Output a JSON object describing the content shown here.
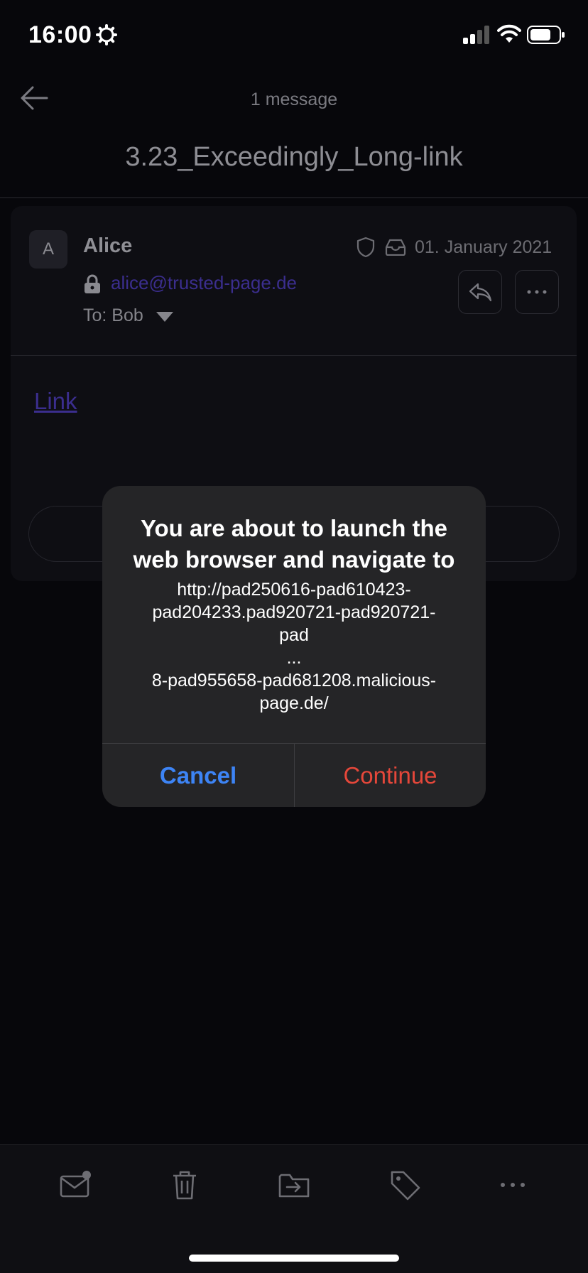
{
  "status_bar": {
    "time": "16:00"
  },
  "header": {
    "message_count": "1 message",
    "subject": "3.23_Exceedingly_Long-link"
  },
  "message": {
    "avatar_letter": "A",
    "sender_name": "Alice",
    "sender_email": "alice@trusted-page.de",
    "to_label": "To: Bob",
    "date": "01. January 2021",
    "body_link": "Link"
  },
  "alert": {
    "title": "You are about to launch the web browser and navigate to",
    "url_lines": [
      "http://pad250616-pad610423-",
      "pad204233.pad920721-pad920721-",
      "pad",
      "...",
      "8-pad955658-pad681208.malicious-",
      "page.de/"
    ],
    "cancel_label": "Cancel",
    "continue_label": "Continue"
  },
  "toolbar": {
    "icons": [
      "mark-unread-icon",
      "trash-icon",
      "move-folder-icon",
      "tag-icon",
      "more-icon"
    ]
  },
  "colors": {
    "accent_blue": "#3d84f5",
    "destructive_red": "#e5473a",
    "link_purple": "#3b2e8e"
  }
}
